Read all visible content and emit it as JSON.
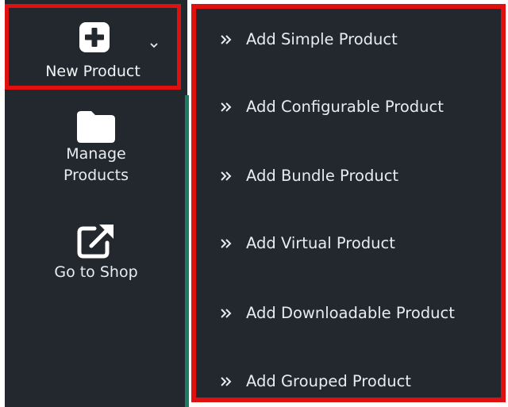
{
  "sidebar": {
    "new_product": {
      "label": "New Product",
      "icon": "plus-square-icon"
    },
    "manage_products": {
      "label_line1": "Manage",
      "label_line2": "Products",
      "icon": "folder-icon"
    },
    "go_to_shop": {
      "label": "Go to Shop",
      "icon": "external-link-icon"
    }
  },
  "flyout": {
    "items": [
      {
        "label": "Add Simple Product"
      },
      {
        "label": "Add Configurable Product"
      },
      {
        "label": "Add Bundle Product"
      },
      {
        "label": "Add Virtual Product"
      },
      {
        "label": "Add Downloadable Product"
      },
      {
        "label": "Add Grouped Product"
      }
    ]
  },
  "colors": {
    "sidebar_bg": "#23272e",
    "highlight_border": "#e01010",
    "accent_green": "#1f7a63",
    "text": "#e9ecef"
  }
}
